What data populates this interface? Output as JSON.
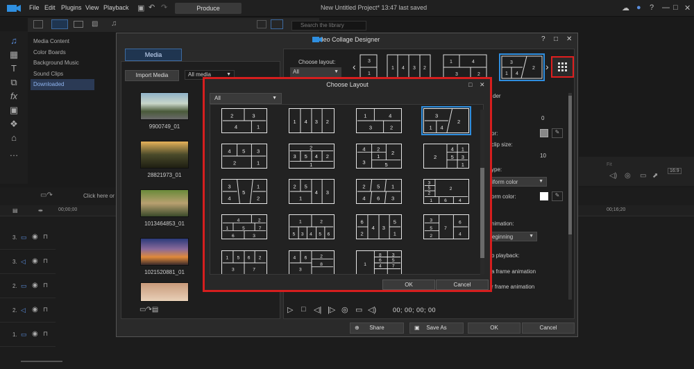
{
  "app": {
    "menu": [
      "File",
      "Edit",
      "Plugins",
      "View",
      "Playback"
    ],
    "produce_label": "Produce",
    "project_title": "New Untitled Project* 13:47 last saved"
  },
  "library": {
    "search_placeholder": "Search the library",
    "categories": [
      "Media Content",
      "Color Boards",
      "Background Music",
      "Sound Clips",
      "Downloaded"
    ],
    "selected_category": "Downloaded"
  },
  "timeline": {
    "tracks": [
      "3.",
      "3.",
      "2.",
      "2.",
      "1."
    ],
    "click_hint": "Click here or",
    "time_start": "00;00;00",
    "time_end": "00;16;20"
  },
  "preview": {
    "quality_label": "Fit",
    "ratio_label": "16:9"
  },
  "collage": {
    "title": "Video Collage Designer",
    "media_tab": "Media",
    "import_label": "Import Media",
    "media_filter": "All media",
    "media": [
      {
        "name": "9900749_01"
      },
      {
        "name": "28821973_01"
      },
      {
        "name": "1013464853_01"
      },
      {
        "name": "1021520881_01"
      }
    ],
    "choose_layout_label": "Choose layout:",
    "layout_filter": "All",
    "properties": [
      {
        "label": "der"
      },
      {
        "label": "0"
      },
      {
        "label": "or:"
      },
      {
        "label": "clip size:"
      },
      {
        "label": "10"
      },
      {
        "label": "ype:"
      },
      {
        "label": "iform color"
      },
      {
        "label": "orm color:"
      },
      {
        "label": "nimation:"
      },
      {
        "label": "eginning"
      },
      {
        "label": "o playback:"
      },
      {
        "label": "a frame animation"
      },
      {
        "label": "r frame animation"
      }
    ],
    "timecode": "00; 00; 00; 00",
    "share_label": "Share",
    "saveas_label": "Save As",
    "ok_label": "OK",
    "cancel_label": "Cancel"
  },
  "choose_layout_dialog": {
    "title": "Choose Layout",
    "filter": "All",
    "ok_label": "OK",
    "cancel_label": "Cancel"
  },
  "colors": {
    "accent_blue": "#2f8fe0",
    "highlight_red": "#d61e1e"
  }
}
